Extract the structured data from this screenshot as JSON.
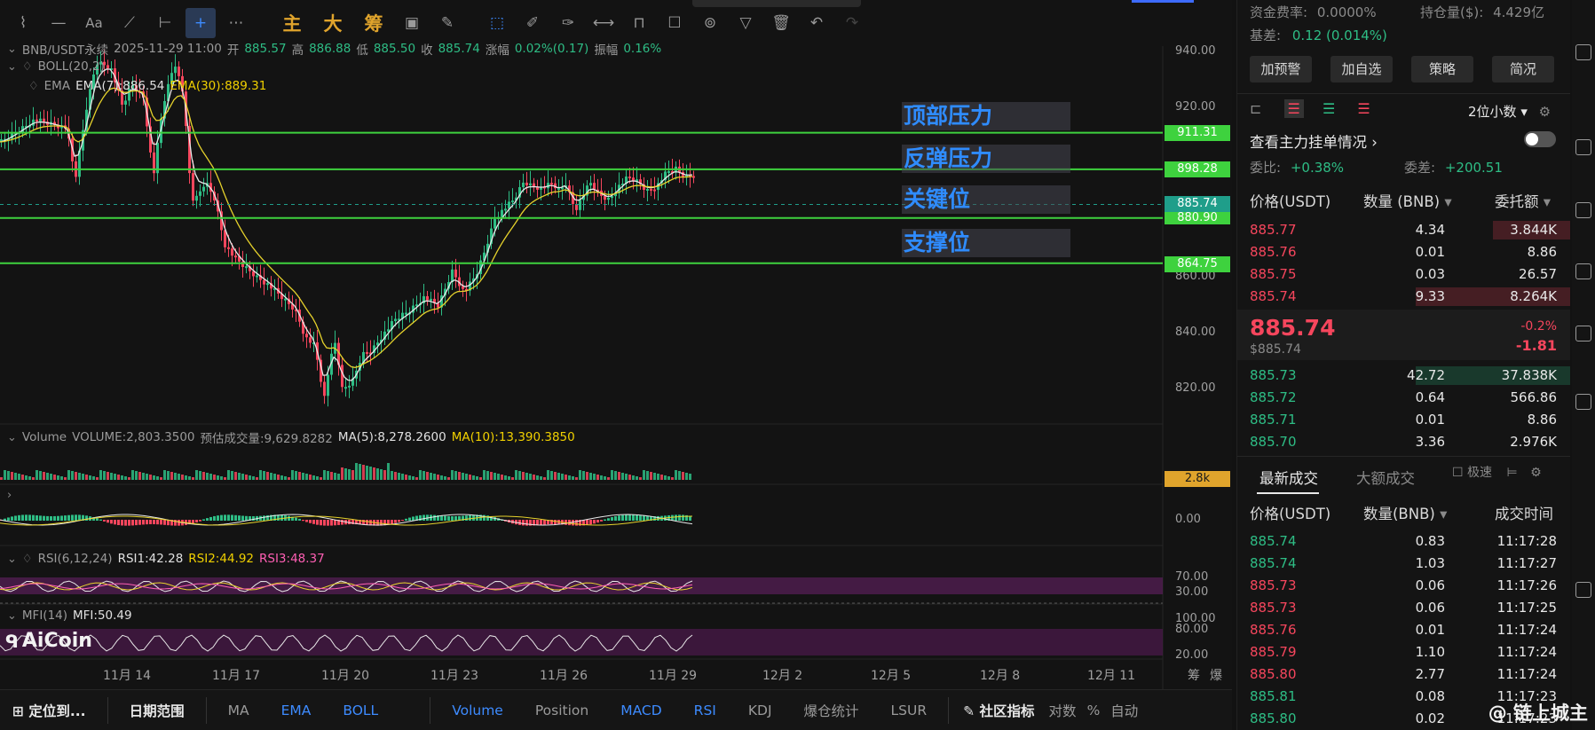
{
  "toolbar": {
    "tools": [
      "cursor-tool",
      "line-tool",
      "text-tool",
      "indicator-tool",
      "horizontal-line-tool",
      "crosshair-tool",
      "more-tool"
    ],
    "gold_buttons": [
      "主",
      "大",
      "筹"
    ]
  },
  "legend": {
    "symbol": "BNB/USDT永续",
    "time": "2025-11-29 11:00",
    "open_label": "开",
    "open": "885.57",
    "high_label": "高",
    "high": "886.88",
    "low_label": "低",
    "low": "885.50",
    "close_label": "收",
    "close": "885.74",
    "change_label": "涨幅",
    "change": "0.02%(0.17)",
    "amp_label": "振幅",
    "amp": "0.16%",
    "boll": "BOLL(20,2)",
    "ema_name": "EMA",
    "ema7": "EMA(7):886.54",
    "ema30": "EMA(30):889.31"
  },
  "zones": {
    "top_pressure": "顶部压力",
    "rebound_pressure": "反弹压力",
    "key_level": "关键位",
    "support": "支撑位"
  },
  "levels": {
    "l1": "911.31",
    "l2": "898.28",
    "current": "885.74",
    "l3": "880.90",
    "l4": "864.75",
    "volume_tag": "2.8k"
  },
  "price_axis": [
    "940.00",
    "920.00",
    "860.00",
    "840.00",
    "820.00"
  ],
  "volume_legend": {
    "name": "Volume",
    "vol": "VOLUME:2,803.3500",
    "est": "预估成交量:9,629.8282",
    "ma5": "MA(5):8,278.2600",
    "ma10": "MA(10):13,390.3850"
  },
  "macd_axis": "0.00",
  "rsi_legend": {
    "name": "RSI(6,12,24)",
    "r1": "RSI1:42.28",
    "r2": "RSI2:44.92",
    "r3": "RSI3:48.37",
    "axis_hi": "70.00",
    "axis_lo": "30.00"
  },
  "mfi_legend": {
    "name": "MFI(14)",
    "val": "MFI:50.49",
    "axis": [
      "100.00",
      "80.00",
      "20.00"
    ]
  },
  "brand": "AiCoin",
  "dates": [
    "11月 14",
    "11月 17",
    "11月 20",
    "11月 23",
    "11月 26",
    "11月 29",
    "12月 2",
    "12月 5",
    "12月 8",
    "12月 11"
  ],
  "date_right": [
    "筹",
    "爆"
  ],
  "bottom_bar": {
    "locate": "定位到...",
    "date_range": "日期范围",
    "items": [
      "MA",
      "EMA",
      "BOLL"
    ],
    "sub_items": [
      "Volume",
      "Position",
      "MACD",
      "RSI",
      "KDJ",
      "爆仓统计",
      "LSUR"
    ],
    "community": "社区指标",
    "log": "对数",
    "pct": "%",
    "auto": "自动"
  },
  "side": {
    "funding_label": "资金费率:",
    "funding": "0.0000%",
    "oi_label": "持仓量($):",
    "oi": "4.429亿",
    "basis_label": "基差:",
    "basis": "0.12 (0.014%)",
    "buttons": [
      "加预警",
      "加自选",
      "策略",
      "简况"
    ],
    "decimals": "2位小数",
    "main_orders": "查看主力挂单情况",
    "ratio_label": "委比:",
    "ratio": "+0.38%",
    "diff_label": "委差:",
    "diff": "+200.51",
    "col_price": "价格(USDT)",
    "col_qty": "数量 (BNB)",
    "col_amount": "委托额",
    "asks": [
      {
        "price": "885.77",
        "qty": "4.34",
        "amt": "3.844K",
        "depth": 0.5
      },
      {
        "price": "885.76",
        "qty": "0.01",
        "amt": "8.86",
        "depth": 0
      },
      {
        "price": "885.75",
        "qty": "0.03",
        "amt": "26.57",
        "depth": 0
      },
      {
        "price": "885.74",
        "qty": "9.33",
        "amt": "8.264K",
        "depth": 1.0
      }
    ],
    "last_price": "885.74",
    "last_usd": "$885.74",
    "last_pct": "-0.2%",
    "last_chg": "-1.81",
    "bids": [
      {
        "price": "885.73",
        "qty": "42.72",
        "amt": "37.838K",
        "depth": 1.0
      },
      {
        "price": "885.72",
        "qty": "0.64",
        "amt": "566.86",
        "depth": 0
      },
      {
        "price": "885.71",
        "qty": "0.01",
        "amt": "8.86",
        "depth": 0
      },
      {
        "price": "885.70",
        "qty": "3.36",
        "amt": "2.976K",
        "depth": 0
      }
    ],
    "tab_latest": "最新成交",
    "tab_large": "大额成交",
    "fast": "极速",
    "trades_col_price": "价格(USDT)",
    "trades_col_qty": "数量(BNB)",
    "trades_col_time": "成交时间",
    "trades": [
      {
        "price": "885.74",
        "qty": "0.83",
        "time": "11:17:28",
        "side": "buy"
      },
      {
        "price": "885.74",
        "qty": "1.03",
        "time": "11:17:27",
        "side": "buy"
      },
      {
        "price": "885.73",
        "qty": "0.06",
        "time": "11:17:26",
        "side": "sell"
      },
      {
        "price": "885.73",
        "qty": "0.06",
        "time": "11:17:25",
        "side": "sell"
      },
      {
        "price": "885.76",
        "qty": "0.01",
        "time": "11:17:24",
        "side": "sell"
      },
      {
        "price": "885.79",
        "qty": "1.10",
        "time": "11:17:24",
        "side": "sell"
      },
      {
        "price": "885.80",
        "qty": "2.77",
        "time": "11:17:24",
        "side": "sell"
      },
      {
        "price": "885.81",
        "qty": "0.08",
        "time": "11:17:23",
        "side": "buy"
      },
      {
        "price": "885.80",
        "qty": "0.02",
        "time": "11:17:23",
        "side": "buy"
      }
    ]
  },
  "watermark": "@ 链上城主",
  "colors": {
    "up": "#2ebd85",
    "down": "#f6465d",
    "level_line": "#3ed23e",
    "zone_text": "#2f8cff",
    "accent": "#3d8bff"
  }
}
